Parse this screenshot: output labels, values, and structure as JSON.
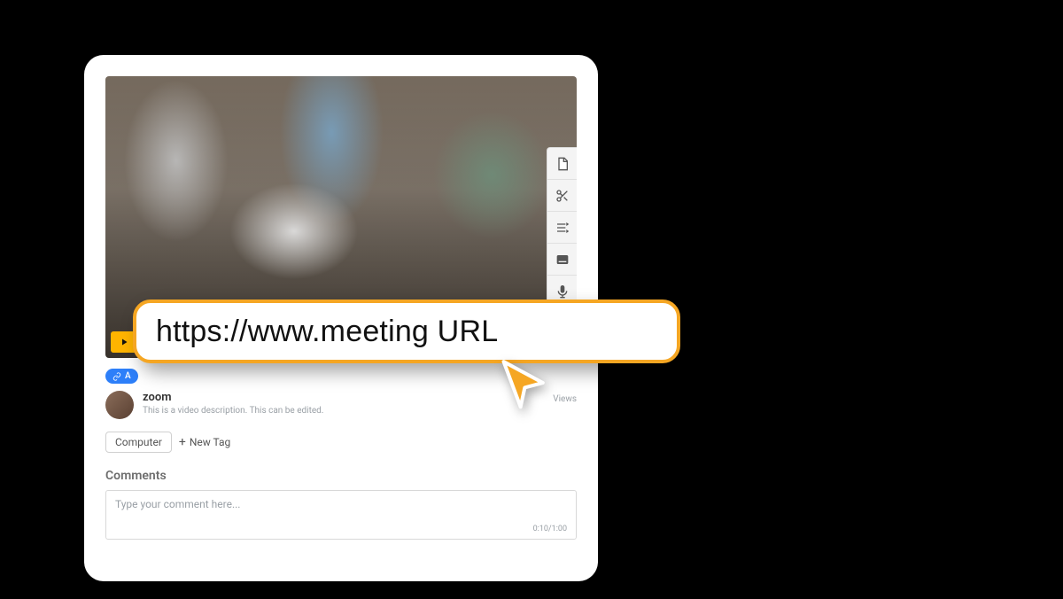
{
  "pill_label": "A",
  "video": {
    "title": "zoom",
    "description": "This is a video description. This can be edited.",
    "views_suffix": "Views"
  },
  "tags": {
    "existing": "Computer",
    "new_tag_label": "New Tag"
  },
  "comments": {
    "heading": "Comments",
    "placeholder": "Type your comment here...",
    "timer": "0:10/1:00"
  },
  "url_callout": "https://www.meeting URL"
}
